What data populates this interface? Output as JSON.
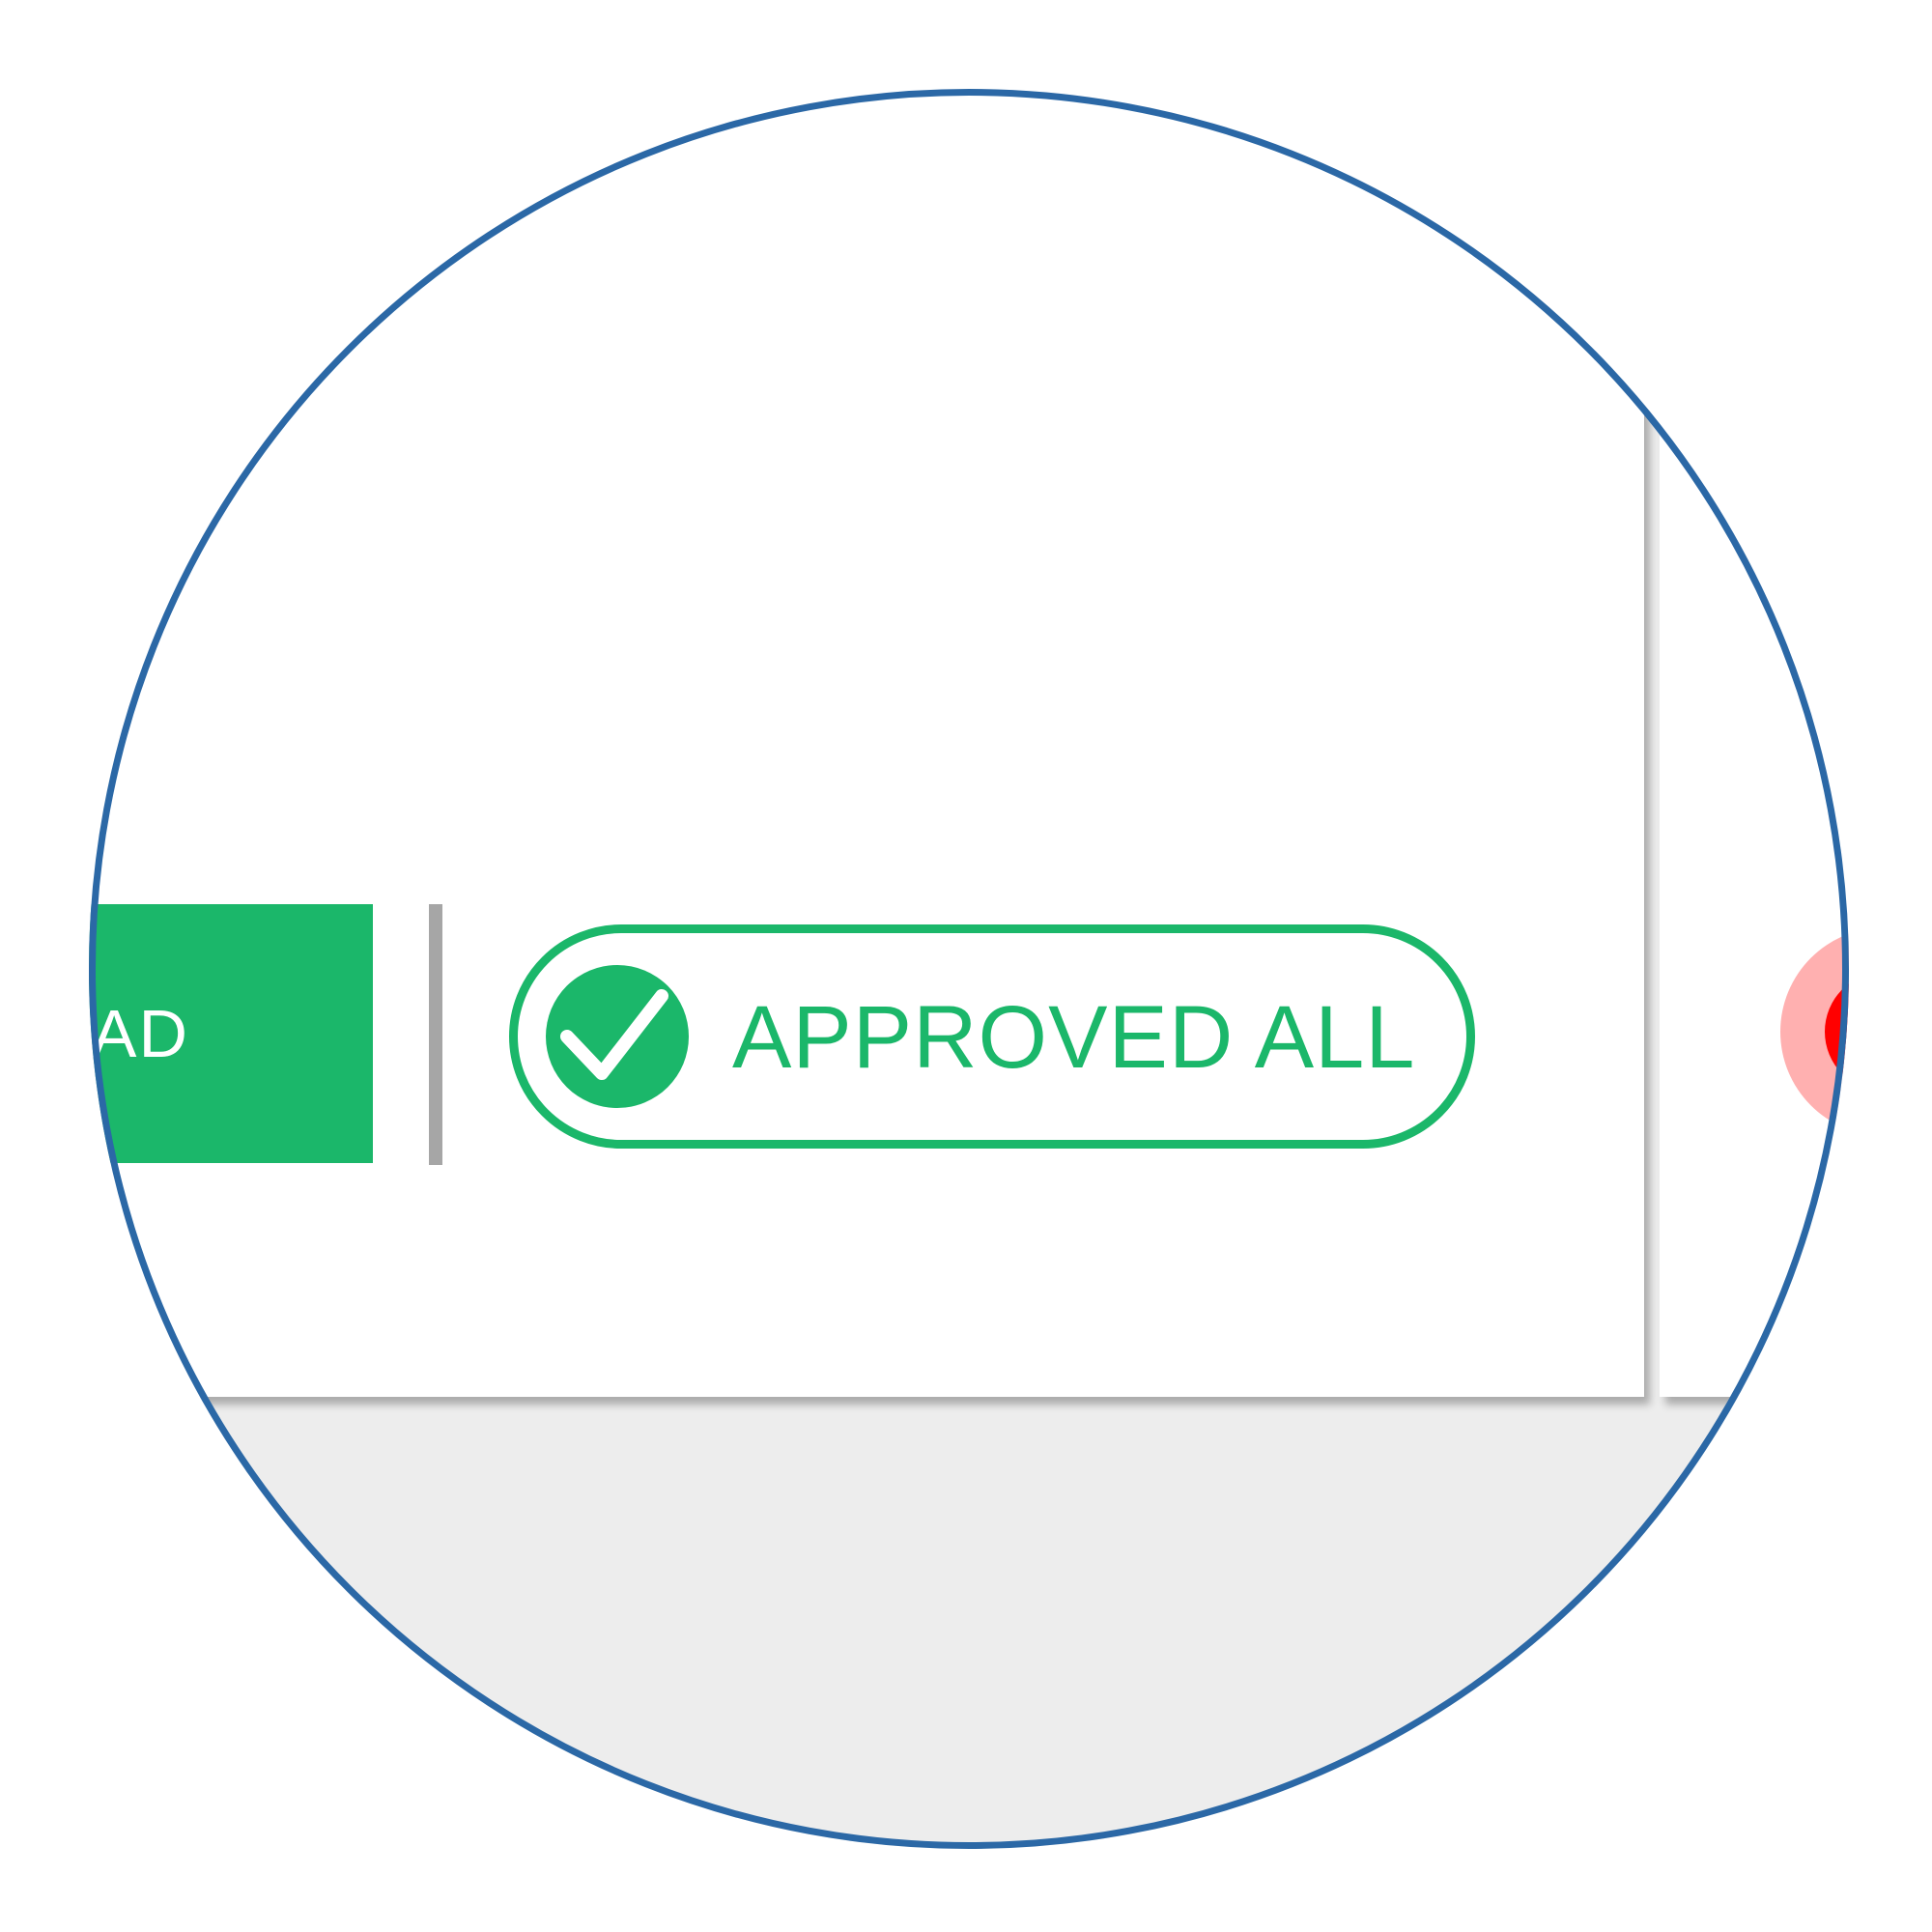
{
  "toolbar": {
    "download_label": "DOWNLOAD",
    "approved_all_label": "APPROVED ALL"
  },
  "icons": {
    "approve": "check-circle-icon",
    "reject": "reject-circle-icon"
  },
  "colors": {
    "accent_green": "#1bb76a",
    "lens_ring": "#2b68a6",
    "divider_gray": "#a6a6a6",
    "reject_red": "#ff0000",
    "reject_halo": "#ffb0b0",
    "page_background": "#ededed"
  }
}
